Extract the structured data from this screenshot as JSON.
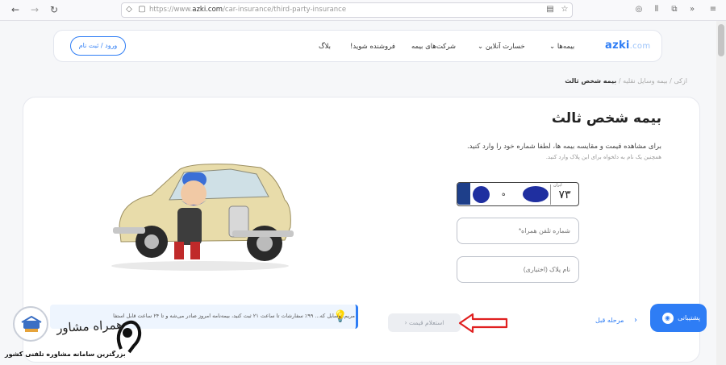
{
  "browser": {
    "url_prefix": "https://www.",
    "url_domain": "azki.com",
    "url_path": "/car-insurance/third-party-insurance",
    "icons": [
      "back-icon",
      "forward-icon",
      "reload-icon",
      "shield-icon",
      "lock-icon",
      "reader-icon",
      "star-icon",
      "pocket-icon",
      "library-icon",
      "extensions-icon",
      "overflow-icon",
      "menu-icon"
    ]
  },
  "header": {
    "logo_main": "azki",
    "logo_suffix": ".com",
    "nav": [
      {
        "label": "بیمه‌ها",
        "dropdown": true
      },
      {
        "label": "خسارت آنلاین",
        "dropdown": true
      },
      {
        "label": "شرکت‌های بیمه",
        "dropdown": true
      },
      {
        "label": "فروشنده شوید!",
        "dropdown": false
      },
      {
        "label": "بلاگ",
        "dropdown": false
      }
    ],
    "login_label": "ورود / ثبت نام",
    "accent_color": "#2e7df5"
  },
  "breadcrumb": {
    "home": "ازکی",
    "section": "بیمه وسایل نقلیه",
    "current": "بیمه شخص ثالث"
  },
  "main": {
    "title": "بیمه شخص ثالث",
    "description": "برای مشاهده قیمت و مقایسه بیمه ها، لطفا شماره خود را وارد کنید.",
    "sub_description": "همچنین یک نام به دلخواه برای این پلاک وارد کنید.",
    "plate": {
      "iran_label": "ایران",
      "code": "۷۳",
      "letter": "ه"
    },
    "phone_placeholder": "شماره تلفن همراه*",
    "plate_name_placeholder": "نام پلاک (اختیاری)"
  },
  "footer_bar": {
    "notice": "۹۹٪ سفارشات تا ساعت ۲۱ ثبت کنید، بیمه‌نامه امروز صادر می‌شه و تا ۲۴ ساعت قابل استفاده است",
    "notice_prefix": "مریم، وسایل که...",
    "inquiry_label": "استعلام قیمت",
    "prev_label": "مرحله قبل",
    "support_label": "پشتیبانی"
  },
  "watermark": {
    "name": "همراه مشاور",
    "tagline": "بزرگترین سامانه مشاوره تلفنی کشور"
  },
  "colors": {
    "accent": "#2e7df5",
    "plate_blue": "#1f2fa0",
    "arrow_red": "#e02020"
  }
}
